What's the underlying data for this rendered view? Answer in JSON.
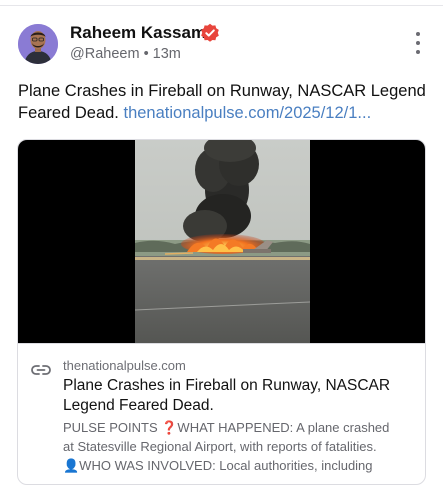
{
  "post": {
    "author_name": "Raheem Kassam",
    "author_handle": "@Raheem",
    "separator": "•",
    "time_ago": "13m",
    "text": "Plane Crashes in Fireball on Runway, NASCAR Legend Feared Dead.",
    "inline_link": "thenationalpulse.com/2025/12/1..."
  },
  "link_card": {
    "domain": "thenationalpulse.com",
    "title": "Plane Crashes in Fireball on Runway, NASCAR Legend Feared Dead.",
    "description_lines": [
      "PULSE POINTS ❓WHAT HAPPENED: A plane crashed",
      "at Statesville Regional Airport, with reports of fatalities.",
      "👤WHO WAS INVOLVED: Local authorities, including"
    ]
  },
  "icons": {
    "verified": "verified-badge-icon",
    "more": "more-vertical-icon",
    "link": "link-chain-icon"
  },
  "colors": {
    "link": "#4a7fc1",
    "verified_badge": "#e8453c",
    "secondary_text": "#66676d"
  }
}
